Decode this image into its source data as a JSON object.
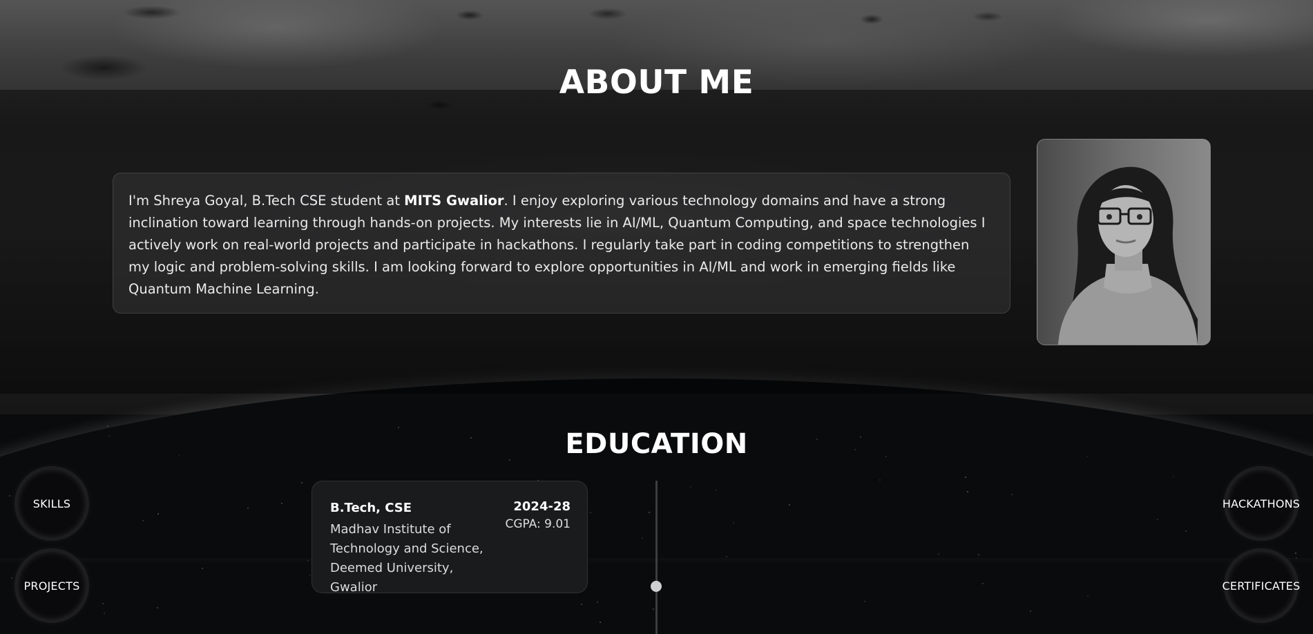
{
  "about": {
    "title": "ABOUT ME",
    "bio_intro": "I'm Shreya Goyal, B.Tech CSE student at ",
    "bio_college": "MITS Gwalior",
    "bio_rest": ". I enjoy exploring various technology domains and have a strong inclination toward learning through hands-on projects. My interests lie in AI/ML, Quantum Computing, and space technologies I actively work on real-world projects and participate in hackathons. I regularly take part in coding competitions to strengthen my logic and problem-solving skills. I am looking forward to explore opportunities in AI/ML and work in emerging fields like Quantum Machine Learning."
  },
  "education": {
    "title": "EDUCATION",
    "entries": [
      {
        "degree": "B.Tech, CSE",
        "school": "Madhav Institute of Technology and Science, Deemed University, Gwalior",
        "years": "2024-28",
        "cgpa": "CGPA: 9.01"
      }
    ]
  },
  "nav": {
    "skills": "SKILLS",
    "projects": "PROJECTS",
    "hackathons": "HACKATHONS",
    "certificates": "CERTIFICATES"
  }
}
